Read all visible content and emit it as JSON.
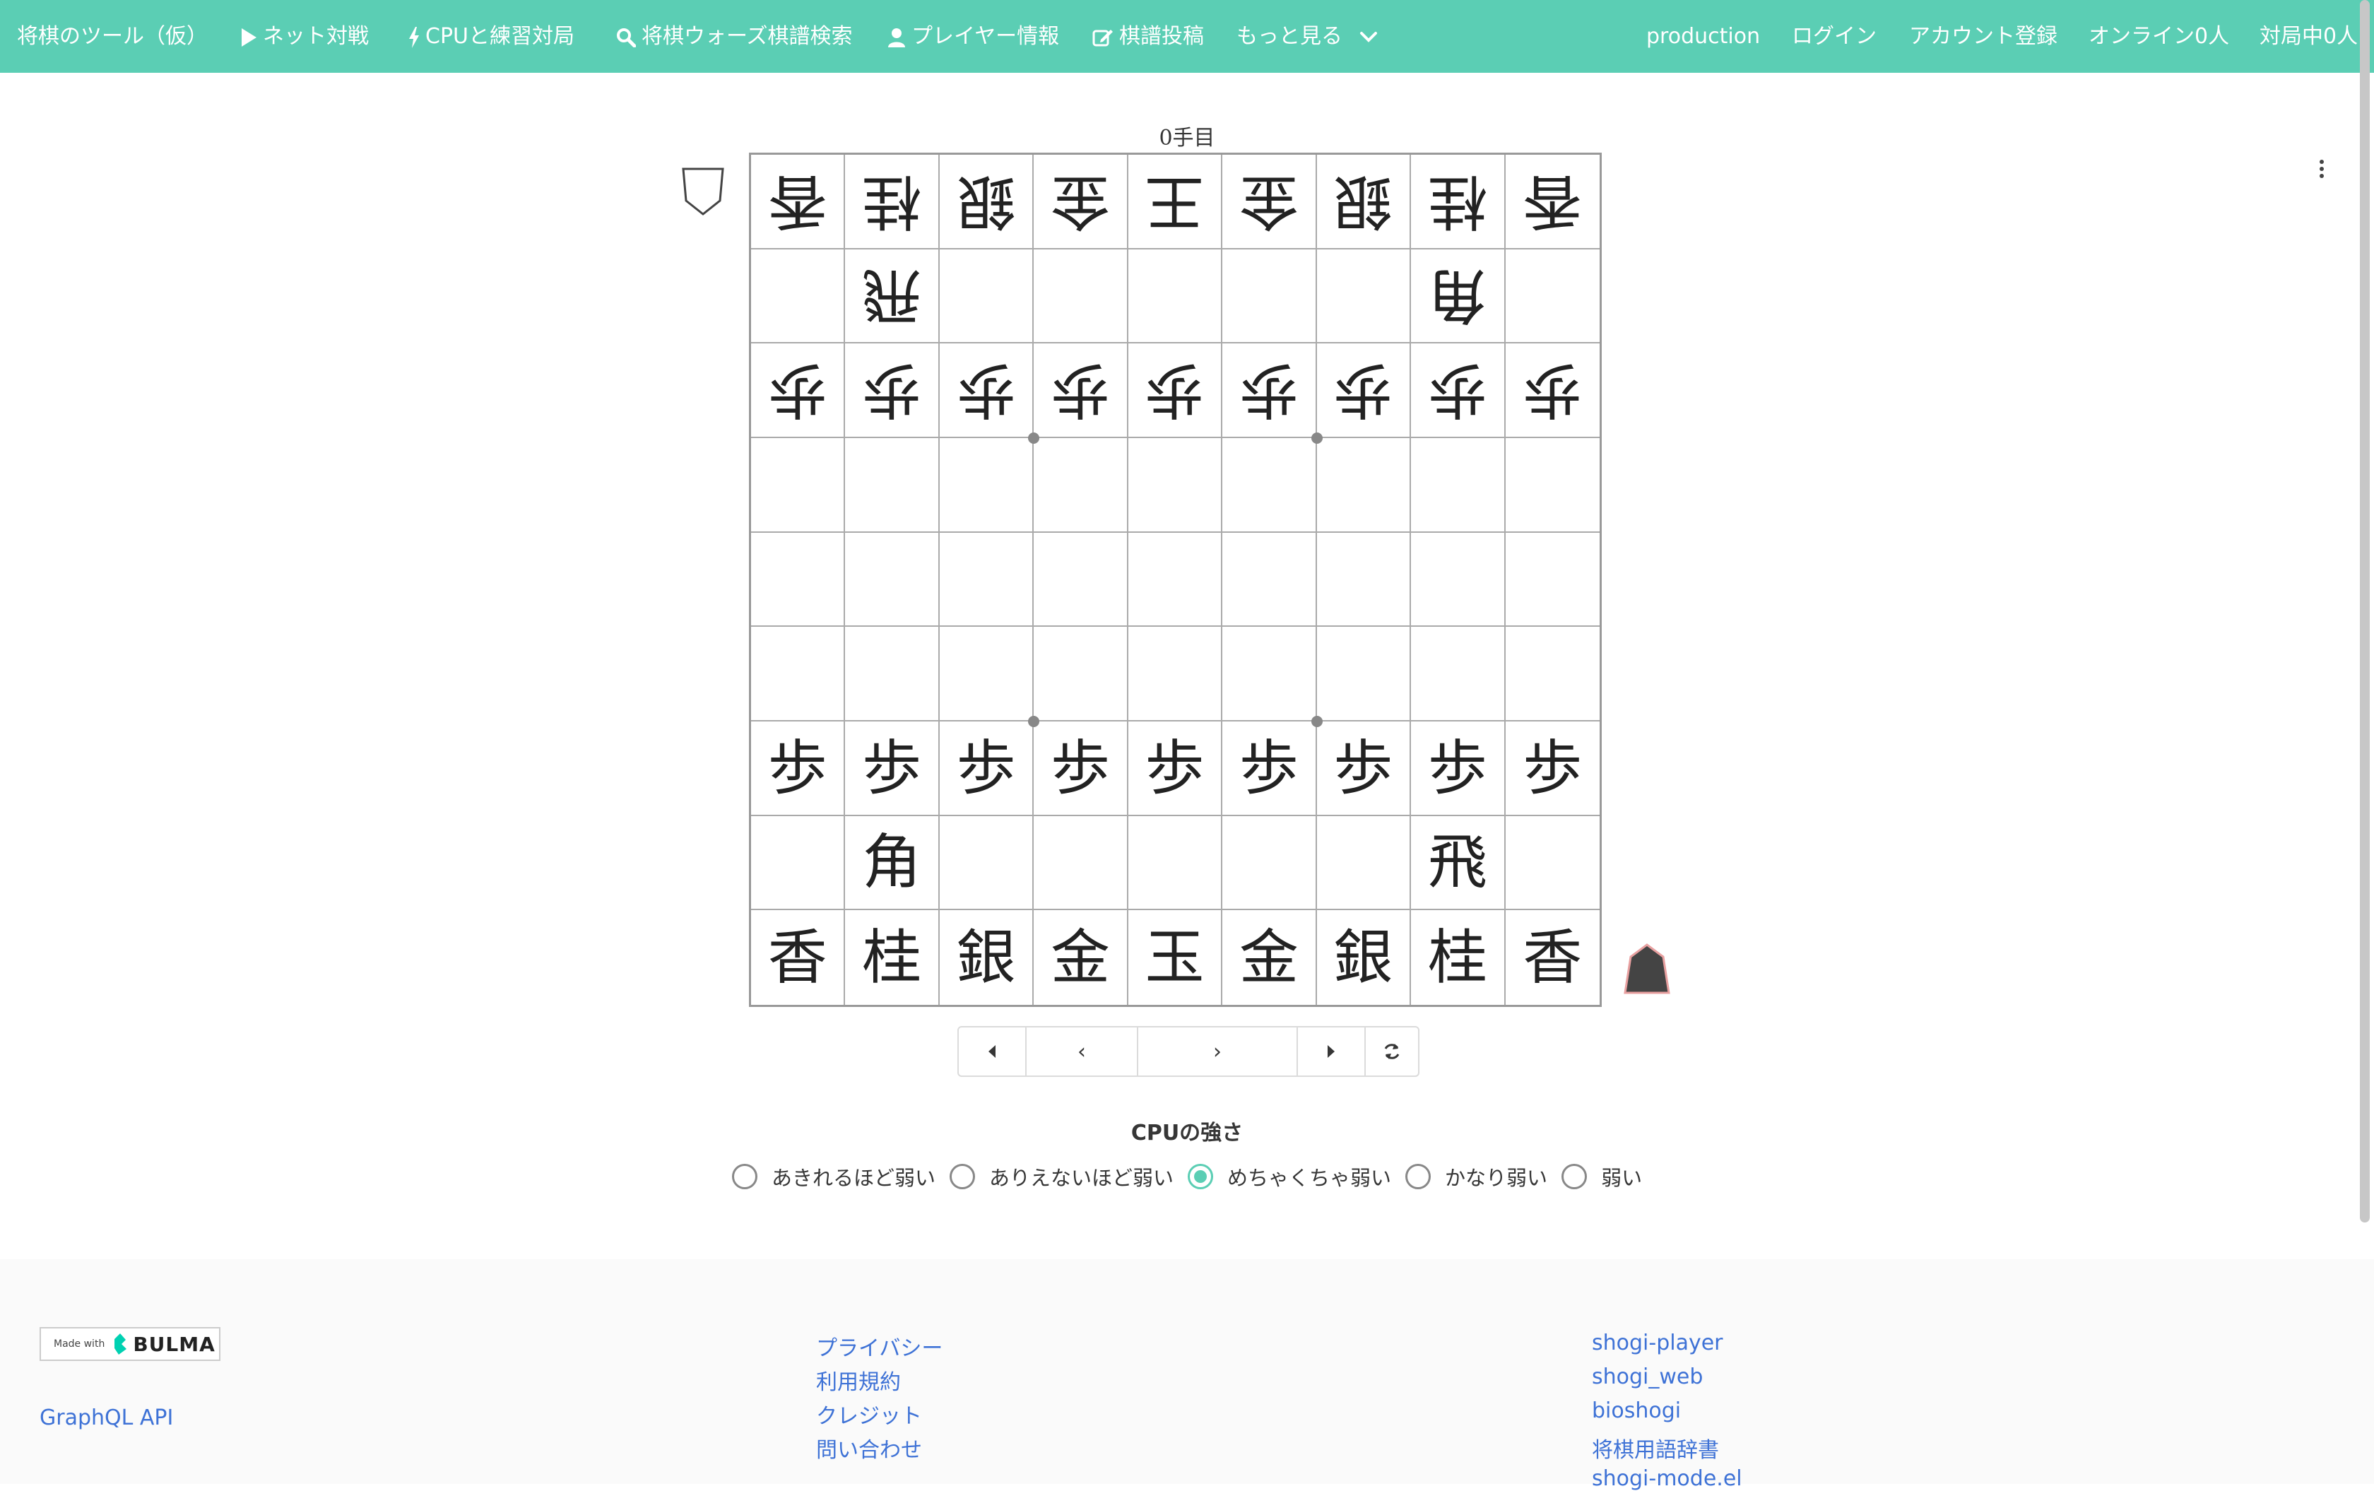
{
  "navbar": {
    "brand": "将棋のツール（仮）",
    "items": [
      {
        "label": "ネット対戦",
        "icon": "play-icon"
      },
      {
        "label": "CPUと練習対局",
        "icon": "bolt-icon"
      },
      {
        "label": "将棋ウォーズ棋譜検索",
        "icon": "search-icon"
      },
      {
        "label": "プレイヤー情報",
        "icon": "user-icon"
      },
      {
        "label": "棋譜投稿",
        "icon": "edit-icon"
      },
      {
        "label": "もっと見る",
        "icon": "chevron-down-icon"
      }
    ],
    "right": [
      "production",
      "ログイン",
      "アカウント登録",
      "オンライン0人",
      "対局中0人"
    ],
    "color": "#5bceb4"
  },
  "board": {
    "move_label": "0手目",
    "rows": [
      [
        "香",
        "桂",
        "銀",
        "金",
        "王",
        "金",
        "銀",
        "桂",
        "香"
      ],
      [
        "",
        "飛",
        "",
        "",
        "",
        "",
        "",
        "角",
        ""
      ],
      [
        "歩",
        "歩",
        "歩",
        "歩",
        "歩",
        "歩",
        "歩",
        "歩",
        "歩"
      ],
      [
        "",
        "",
        "",
        "",
        "",
        "",
        "",
        "",
        ""
      ],
      [
        "",
        "",
        "",
        "",
        "",
        "",
        "",
        "",
        ""
      ],
      [
        "",
        "",
        "",
        "",
        "",
        "",
        "",
        "",
        ""
      ],
      [
        "歩",
        "歩",
        "歩",
        "歩",
        "歩",
        "歩",
        "歩",
        "歩",
        "歩"
      ],
      [
        "",
        "角",
        "",
        "",
        "",
        "",
        "",
        "飛",
        ""
      ],
      [
        "香",
        "桂",
        "銀",
        "金",
        "玉",
        "金",
        "銀",
        "桂",
        "香"
      ]
    ],
    "gote_rows": [
      0,
      1,
      2
    ]
  },
  "controls": {
    "first": "first-move-icon",
    "prev": "‹",
    "next": "›",
    "last": "last-move-icon",
    "flip": "flip-icon"
  },
  "cpu": {
    "title": "CPUの強さ",
    "options": [
      "あきれるほど弱い",
      "ありえないほど弱い",
      "めちゃくちゃ弱い",
      "かなり弱い",
      "弱い"
    ],
    "selected": 2
  },
  "footer": {
    "badge_made_with": "Made with",
    "badge_bulma": "BULMA",
    "graphql": "GraphQL API",
    "links_middle": [
      "プライバシー",
      "利用規約",
      "クレジット",
      "問い合わせ"
    ],
    "links_right": [
      "shogi-player",
      "shogi_web",
      "bioshogi",
      "将棋用語辞書",
      "shogi-mode.el"
    ]
  }
}
